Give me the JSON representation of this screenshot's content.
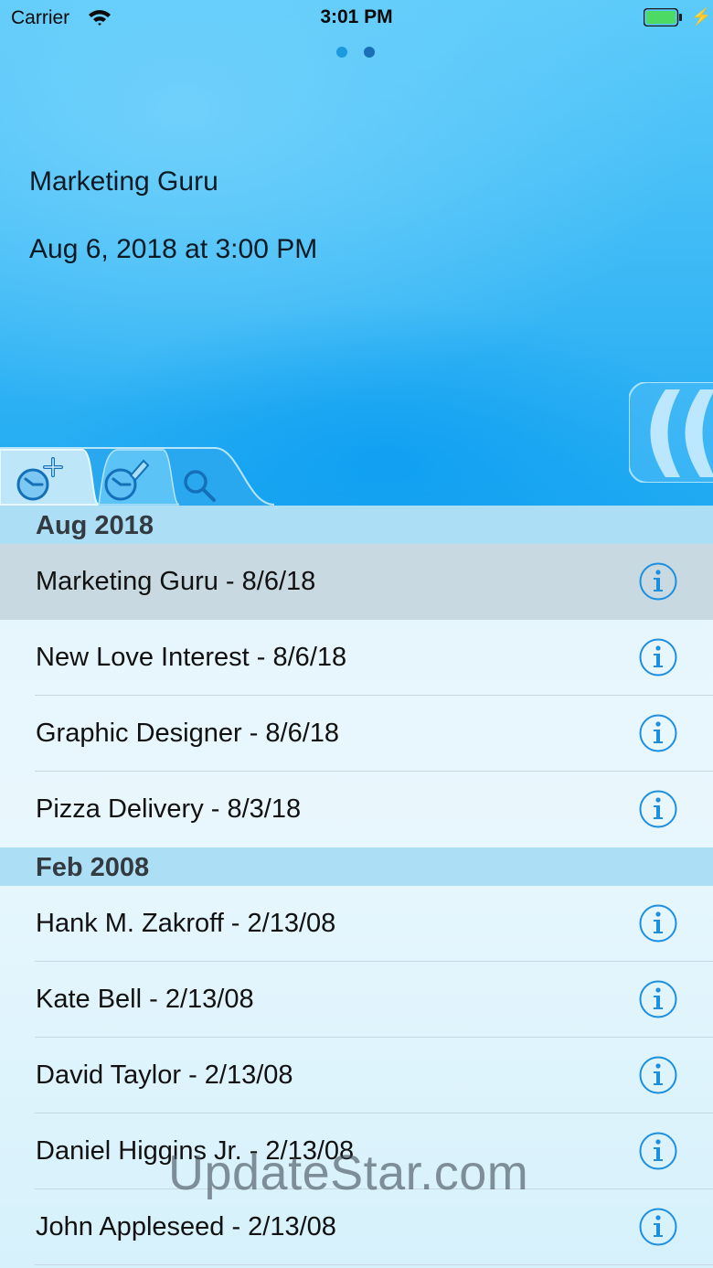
{
  "status_bar": {
    "carrier": "Carrier",
    "time": "3:01 PM"
  },
  "detail": {
    "name": "Marketing Guru",
    "date": "Aug 6, 2018 at 3:00 PM"
  },
  "tabs": [
    {
      "icon": "clock-add-icon"
    },
    {
      "icon": "clock-edit-icon"
    },
    {
      "icon": "search-icon"
    }
  ],
  "sections": [
    {
      "title": "Aug 2018",
      "rows": [
        {
          "label": "Marketing Guru  -  8/6/18",
          "selected": true
        },
        {
          "label": "New Love Interest  -  8/6/18"
        },
        {
          "label": "Graphic Designer  -  8/6/18"
        },
        {
          "label": "Pizza Delivery  -  8/3/18"
        }
      ]
    },
    {
      "title": "Feb 2008",
      "rows": [
        {
          "label": "Hank M. Zakroff  -  2/13/08"
        },
        {
          "label": "Kate Bell  -  2/13/08"
        },
        {
          "label": "David Taylor  -  2/13/08"
        },
        {
          "label": "Daniel Higgins Jr.  -  2/13/08"
        },
        {
          "label": "John Appleseed  -  2/13/08"
        }
      ]
    }
  ],
  "watermark": "UpdateStar.com",
  "colors": {
    "accent": "#1c8fe0",
    "battery": "#4cd964"
  }
}
